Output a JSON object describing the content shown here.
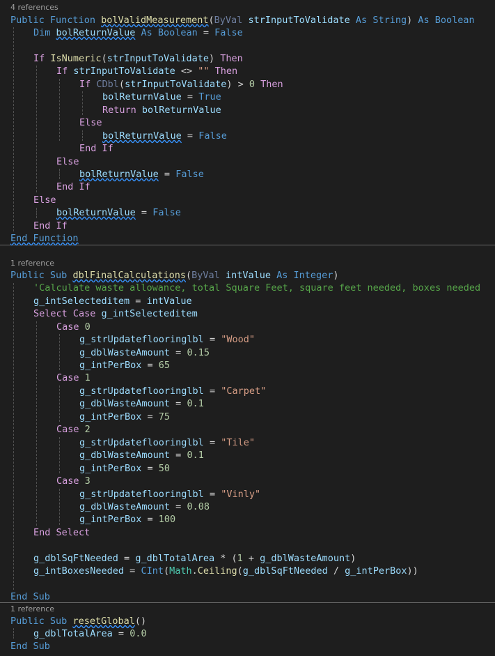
{
  "code_lens": {
    "func_refs": "4 references",
    "sub1_refs": "1 reference",
    "sub2_refs": "1 reference"
  },
  "kw": {
    "public": "Public",
    "function": "Function",
    "byval": "ByVal",
    "as": "As",
    "string_type": "String",
    "boolean_type": "Boolean",
    "integer_type": "Integer",
    "dim": "Dim",
    "false": "False",
    "true": "True",
    "if": "If",
    "then": "Then",
    "return": "Return",
    "else": "Else",
    "end_if": "End If",
    "end_function": "End Function",
    "sub": "Sub",
    "select_case": "Select Case",
    "case": "Case",
    "end_select": "End Select",
    "end_sub": "End Sub"
  },
  "names": {
    "valid_fn": "bolValidMeasurement",
    "param_str": "strInputToValidate",
    "ret_var": "bolReturnValue",
    "isnumeric": "IsNumeric",
    "cdbl": "CDbl",
    "final_calc": "dblFinalCalculations",
    "int_value": "intValue",
    "selected_item": "g_intSelecteditem",
    "label_var": "g_strUpdateflooringlbl",
    "waste_var": "g_dblWasteAmount",
    "per_box_var": "g_intPerBox",
    "sqft_needed": "g_dblSqFtNeeded",
    "total_area": "g_dblTotalArea",
    "boxes_needed": "g_intBoxesNeeded",
    "cint": "CInt",
    "math": "Math",
    "ceiling": "Ceiling",
    "reset_global": "resetGlobal"
  },
  "literals": {
    "empty_str": "\"\"",
    "zero": "0",
    "one": "1",
    "case_0": "0",
    "case_1": "1",
    "case_2": "2",
    "case_3": "3",
    "wood": "\"Wood\"",
    "carpet": "\"Carpet\"",
    "tile": "\"Tile\"",
    "vinly": "\"Vinly\"",
    "waste_wood": "0.15",
    "waste_carpet": "0.1",
    "waste_tile": "0.1",
    "waste_vinly": "0.08",
    "box_wood": "65",
    "box_carpet": "75",
    "box_tile": "50",
    "box_vinly": "100",
    "zero_point_zero": "0.0"
  },
  "comments": {
    "calc": "'Calculate waste allowance, total Square Feet, square feet needed, boxes needed"
  }
}
